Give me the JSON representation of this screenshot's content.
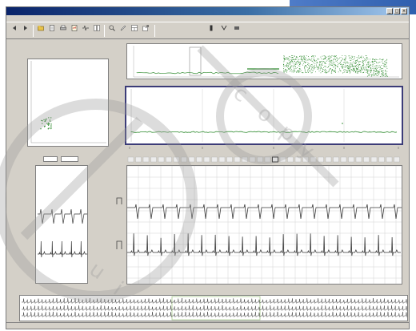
{
  "window": {
    "title": "",
    "controls": [
      "_",
      "□",
      "×"
    ]
  },
  "menubar": [],
  "toolbar": {
    "buttons": [
      {
        "icon": "back-arrow-icon",
        "label": ""
      },
      {
        "icon": "forward-arrow-icon",
        "label": ""
      },
      {
        "icon": "open-folder-icon",
        "label": ""
      },
      {
        "icon": "document-icon",
        "label": ""
      },
      {
        "icon": "print-icon",
        "label": ""
      },
      {
        "icon": "report-icon",
        "label": ""
      },
      {
        "icon": "waveform-icon",
        "label": ""
      },
      {
        "icon": "compare-icon",
        "label": ""
      },
      {
        "icon": "zoom-icon",
        "label": ""
      },
      {
        "icon": "pen-icon",
        "label": ""
      },
      {
        "icon": "layout-icon",
        "label": ""
      },
      {
        "icon": "export-icon",
        "label": ""
      }
    ]
  },
  "panes": {
    "scatter": {
      "xaxis_label": ""
    },
    "trend_overview": {},
    "trend_detail": {},
    "template_view": {
      "field_1": "",
      "field_2": ""
    },
    "ecg_strip": {},
    "full_disclosure": {}
  },
  "statusbar": {
    "left": "",
    "right": ""
  },
  "colors": {
    "trend_green": "#2d8a2d",
    "selection_frame": "#3c3c78",
    "ecg_trace": "#3a3a3a",
    "grid": "#c9c9c9",
    "watermark": "#9a9a9a",
    "banner_blue": "#2f5fae"
  }
}
